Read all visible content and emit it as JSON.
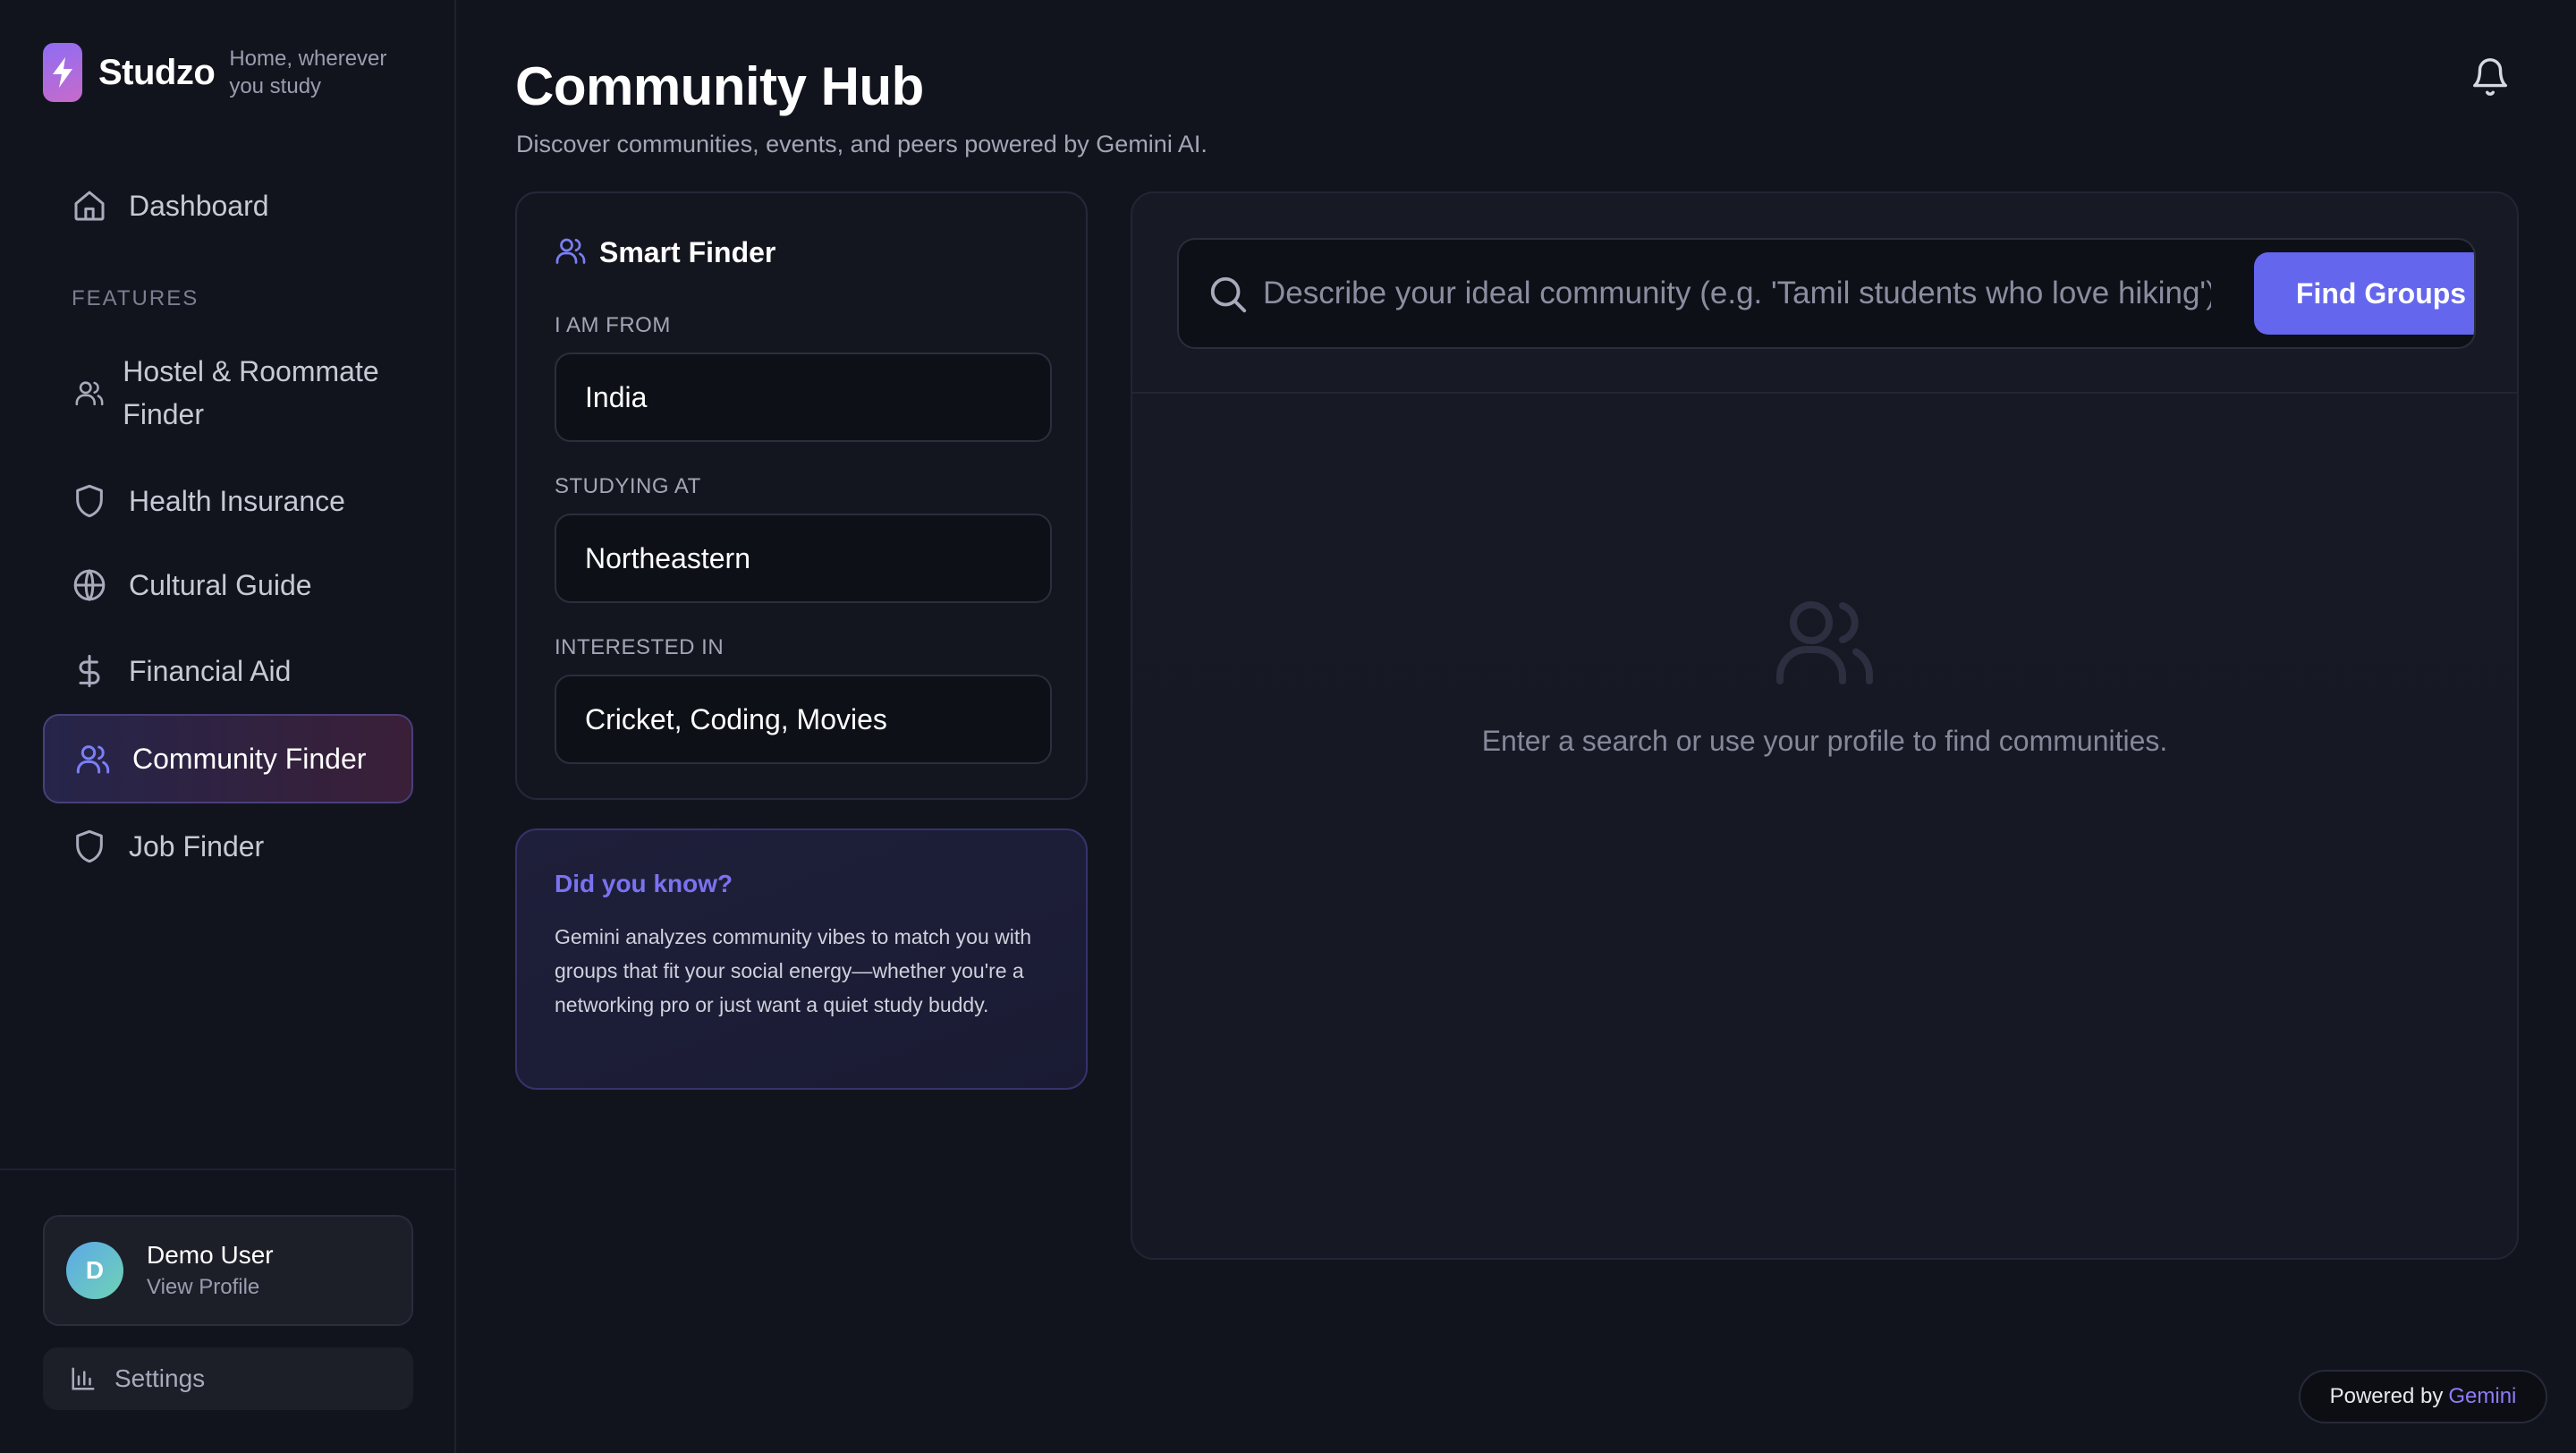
{
  "brand": {
    "name": "Studzo",
    "tagline": "Home, wherever you study"
  },
  "sidebar": {
    "dashboard": "Dashboard",
    "section_label": "FEATURES",
    "items": [
      {
        "label": "Hostel & Roommate Finder",
        "icon": "users-icon"
      },
      {
        "label": "Health Insurance",
        "icon": "shield-icon"
      },
      {
        "label": "Cultural Guide",
        "icon": "globe-icon"
      },
      {
        "label": "Financial Aid",
        "icon": "dollar-icon"
      },
      {
        "label": "Community Finder",
        "icon": "users-icon",
        "active": true
      },
      {
        "label": "Job Finder",
        "icon": "shield-icon"
      }
    ]
  },
  "user": {
    "initial": "D",
    "name": "Demo User",
    "sub": "View Profile"
  },
  "settings": {
    "label": "Settings"
  },
  "header": {
    "title": "Community Hub",
    "subtitle": "Discover communities, events, and peers powered by Gemini AI."
  },
  "smart_finder": {
    "title": "Smart Finder",
    "from_label": "I AM FROM",
    "from_value": "India",
    "studying_label": "STUDYING AT",
    "studying_value": "Northeastern",
    "interested_label": "INTERESTED IN",
    "interested_value": "Cricket, Coding, Movies"
  },
  "tip": {
    "title": "Did you know?",
    "text": "Gemini analyzes community vibes to match you with groups that fit your social energy—whether you're a networking pro or just want a quiet study buddy."
  },
  "search": {
    "placeholder": "Describe your ideal community (e.g. 'Tamil students who love hiking')",
    "button": "Find Groups"
  },
  "empty_state": {
    "text": "Enter a search or use your profile to find communities."
  },
  "footer": {
    "powered_prefix": "Powered by",
    "powered_brand": "Gemini"
  },
  "colors": {
    "accent": "#6466ee",
    "tip_title": "#7b72f0",
    "background": "#12141d"
  }
}
